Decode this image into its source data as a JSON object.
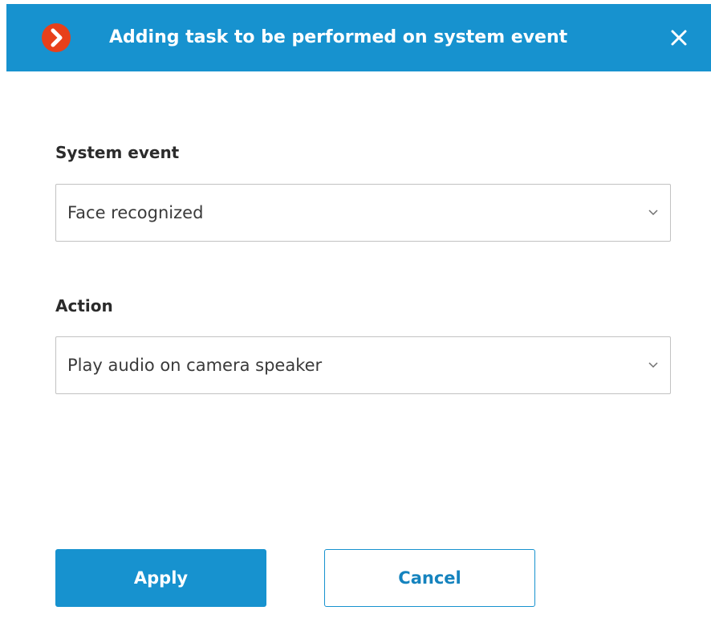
{
  "dialog": {
    "title": "Adding task to be performed on system event",
    "logo_icon": "arrow-right-logo-icon",
    "close_icon": "close-icon",
    "accent_color": "#1792cf",
    "logo_color": "#e8401a"
  },
  "system_event": {
    "label": "System event",
    "value": "Face recognized",
    "dropdown_icon": "chevron-down-icon"
  },
  "action": {
    "label": "Action",
    "value": "Play audio on camera speaker",
    "dropdown_icon": "chevron-down-icon"
  },
  "buttons": {
    "apply_label": "Apply",
    "cancel_label": "Cancel"
  }
}
